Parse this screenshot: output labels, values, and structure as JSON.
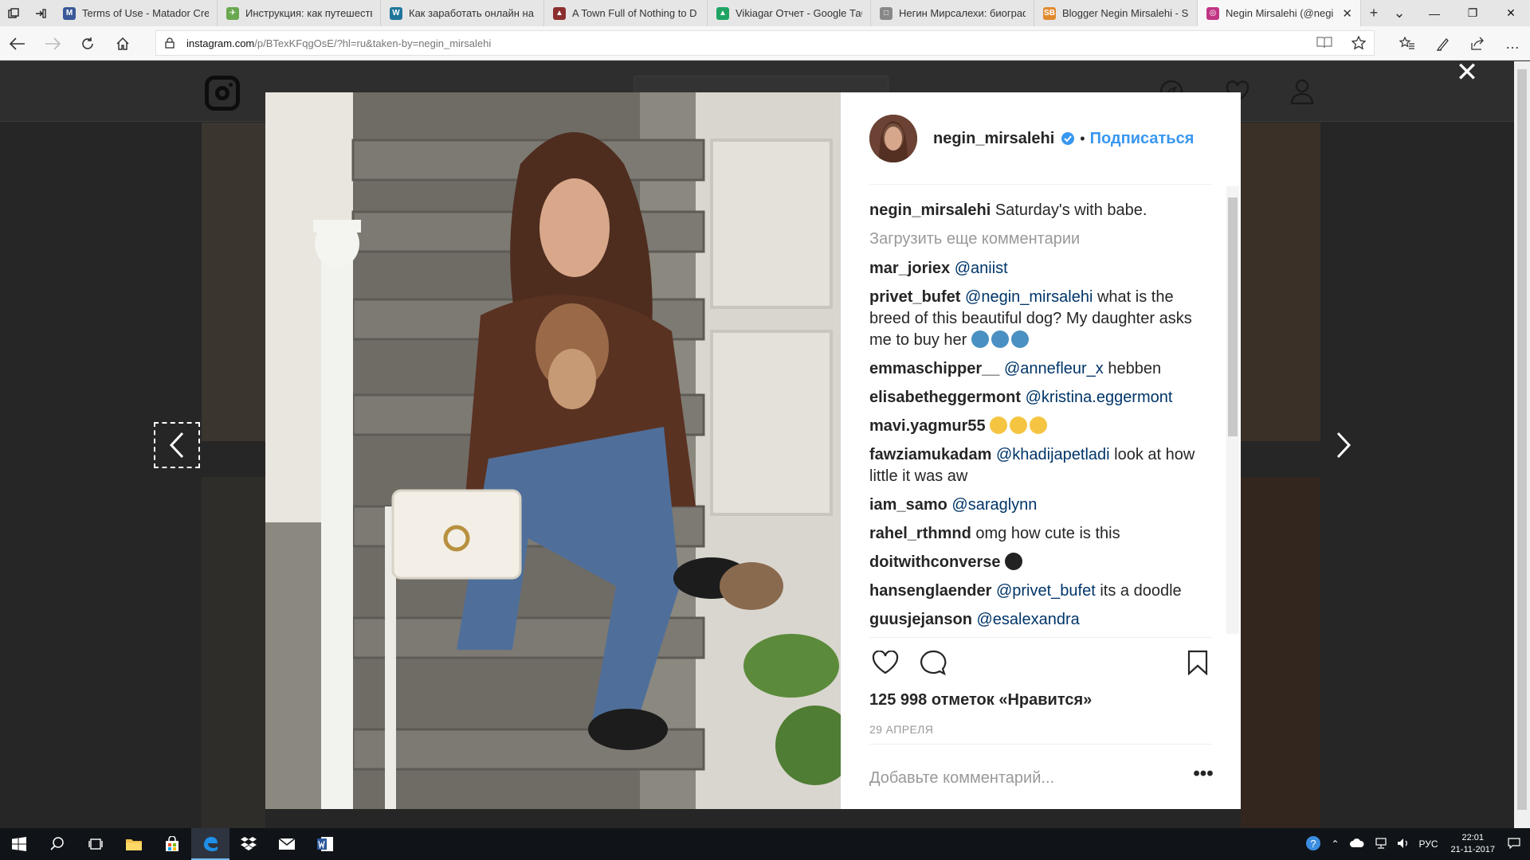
{
  "browser": {
    "tabs": [
      {
        "title": "Terms of Use - Matador Cre",
        "favicon_color": "#3b5998",
        "favicon_glyph": "M"
      },
      {
        "title": "Инструкция: как путешеств",
        "favicon_color": "#6aa84f",
        "favicon_glyph": "✈"
      },
      {
        "title": "Как заработать онлайн на",
        "favicon_color": "#21759b",
        "favicon_glyph": "W"
      },
      {
        "title": "A Town Full of Nothing to D",
        "favicon_color": "#8b2e2e",
        "favicon_glyph": "▲"
      },
      {
        "title": "Vikiagar Отчет - Google Таб",
        "favicon_color": "#1fa463",
        "favicon_glyph": "▲"
      },
      {
        "title": "Негин Мирсалехи: биограф",
        "favicon_color": "#888888",
        "favicon_glyph": "□"
      },
      {
        "title": "Blogger Negin Mirsalehi - S",
        "favicon_color": "#e08a2e",
        "favicon_glyph": "SB"
      },
      {
        "title": "Negin Mirsalehi (@negi",
        "favicon_color": "#c13584",
        "favicon_glyph": "◎",
        "active": true
      }
    ],
    "url_host": "instagram.com",
    "url_rest": "/p/BTexKFqgOsE/?hl=ru&taken-by=negin_mirsalehi"
  },
  "post": {
    "username": "negin_mirsalehi",
    "follow_label": "Подписаться",
    "dot": "•",
    "caption_user": "negin_mirsalehi",
    "caption_text": "Saturday's with babe.",
    "load_more": "Загрузить еще комментарии",
    "comments": [
      {
        "user": "mar_joriex",
        "mention": "@aniist",
        "text": ""
      },
      {
        "user": "privet_bufet",
        "mention": "@negin_mirsalehi",
        "text": "what is the breed of this beautiful dog? My daughter asks me to buy her",
        "emoji": [
          "#4a90c2",
          "#4a90c2",
          "#4a90c2"
        ]
      },
      {
        "user": "emmaschipper__",
        "mention": "@annefleur_x",
        "text": "hebben"
      },
      {
        "user": "elisabetheggermont",
        "mention": "@kristina.eggermont",
        "text": ""
      },
      {
        "user": "mavi.yagmur55",
        "mention": "",
        "text": "",
        "emoji": [
          "#f5c542",
          "#f5c542",
          "#f5c542"
        ]
      },
      {
        "user": "fawziamukadam",
        "mention": "@khadijapetladi",
        "text": "look at how little it was aw"
      },
      {
        "user": "iam_samo",
        "mention": "@saraglynn",
        "text": ""
      },
      {
        "user": "rahel_rthmnd",
        "mention": "",
        "text": "omg how cute is this"
      },
      {
        "user": "doitwithconverse",
        "mention": "",
        "text": "",
        "emoji": [
          "#222222"
        ]
      },
      {
        "user": "hansenglaender",
        "mention": "@privet_bufet",
        "text": "its a doodle"
      },
      {
        "user": "guusjejanson",
        "mention": "@esalexandra",
        "text": ""
      }
    ],
    "likes": "125 998 отметок «Нравится»",
    "date": "29 АПРЕЛЯ",
    "comment_placeholder": "Добавьте комментарий...",
    "more_options": "•••"
  },
  "taskbar": {
    "language": "РУС",
    "time": "22:01",
    "date": "21-11-2017"
  },
  "colors": {
    "link": "#3897f0",
    "mention": "#003569",
    "muted": "#999999"
  }
}
